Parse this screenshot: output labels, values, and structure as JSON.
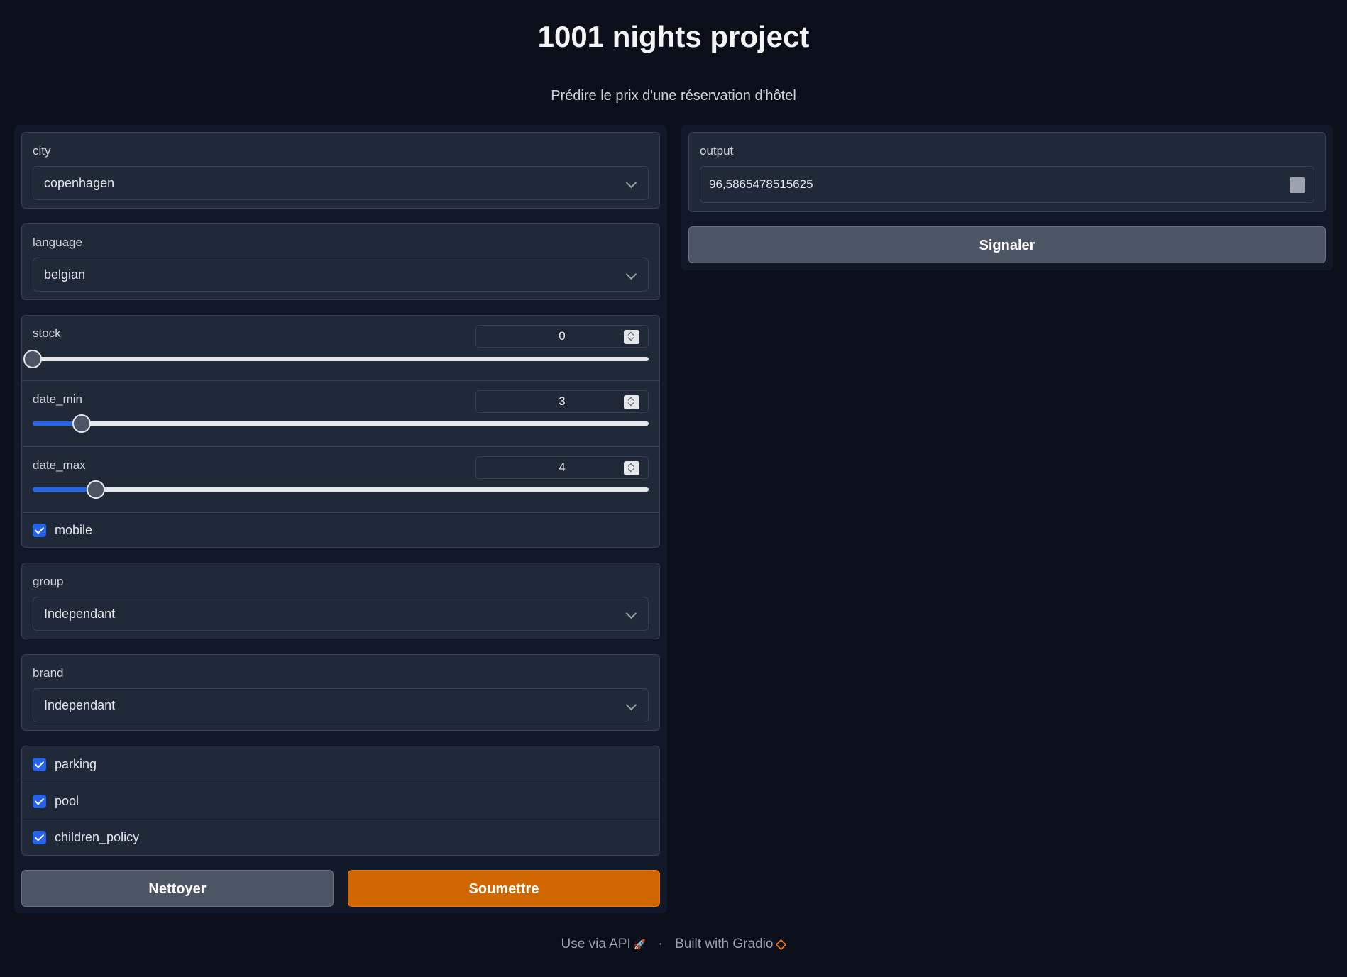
{
  "header": {
    "title": "1001 nights project",
    "subtitle": "Prédire le prix d'une réservation d'hôtel"
  },
  "inputs": {
    "city": {
      "label": "city",
      "value": "copenhagen"
    },
    "language": {
      "label": "language",
      "value": "belgian"
    },
    "stock": {
      "label": "stock",
      "value": "0",
      "fraction": 0.0
    },
    "date_min": {
      "label": "date_min",
      "value": "3",
      "fraction": 0.08
    },
    "date_max": {
      "label": "date_max",
      "value": "4",
      "fraction": 0.102
    },
    "mobile": {
      "label": "mobile",
      "checked": true
    },
    "group": {
      "label": "group",
      "value": "Independant"
    },
    "brand": {
      "label": "brand",
      "value": "Independant"
    },
    "parking": {
      "label": "parking",
      "checked": true
    },
    "pool": {
      "label": "pool",
      "checked": true
    },
    "children_policy": {
      "label": "children_policy",
      "checked": true
    }
  },
  "buttons": {
    "clear": "Nettoyer",
    "submit": "Soumettre",
    "flag": "Signaler"
  },
  "output": {
    "label": "output",
    "value": "96,5865478515625"
  },
  "footer": {
    "api": "Use via API",
    "separator": "·",
    "built": "Built with Gradio"
  },
  "colors": {
    "background": "#0b0f19",
    "panel": "#1f2937",
    "accent": "#2563eb",
    "primary_button": "#d06600"
  }
}
